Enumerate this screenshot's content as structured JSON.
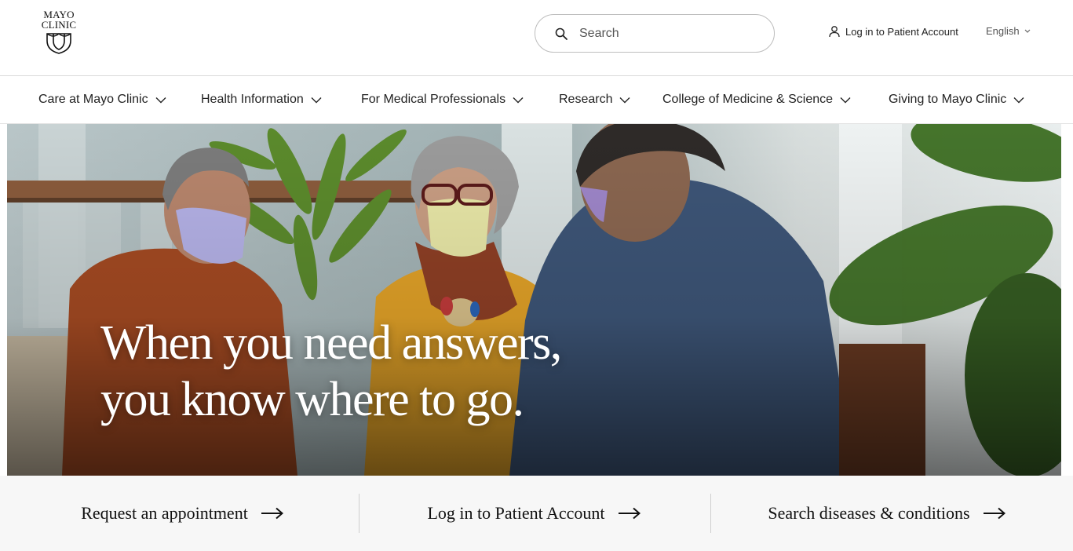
{
  "header": {
    "logo_line1": "MAYO",
    "logo_line2": "CLINIC",
    "search_placeholder": "Search",
    "login_label": "Log in to Patient Account",
    "language_label": "English"
  },
  "nav": {
    "items": [
      {
        "label": "Care at Mayo Clinic"
      },
      {
        "label": "Health Information"
      },
      {
        "label": "For Medical Professionals"
      },
      {
        "label": "Research"
      },
      {
        "label": "College of Medicine & Science"
      },
      {
        "label": "Giving to Mayo Clinic"
      }
    ]
  },
  "hero": {
    "title_line1": "When you need answers,",
    "title_line2": "you know where to go."
  },
  "cta": {
    "items": [
      {
        "label": "Request an appointment"
      },
      {
        "label": "Log in to Patient Account"
      },
      {
        "label": "Search diseases & conditions"
      }
    ]
  },
  "icons": {
    "search": "search-icon",
    "user": "user-icon",
    "chevron": "chevron-down-icon",
    "arrow": "arrow-right-icon"
  },
  "colors": {
    "text": "#222222",
    "border": "#d9d9d9",
    "cta_background": "#f7f7f7"
  }
}
